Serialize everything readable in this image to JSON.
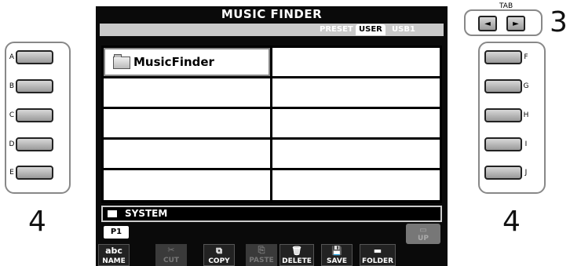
{
  "screen": {
    "title": "MUSIC FINDER",
    "tabs": {
      "preset": "PRESET",
      "user": "USER",
      "usb": "USB1"
    },
    "files": [
      {
        "label": "MusicFinder",
        "type": "folder",
        "selected": true
      }
    ],
    "system_label": "SYSTEM",
    "page_tab": "P1",
    "up_label": "UP",
    "bottom_buttons": [
      {
        "label": "NAME",
        "enabled": true,
        "glyph": "abc"
      },
      {
        "label": "CUT",
        "enabled": false,
        "glyph": "✂"
      },
      {
        "label": "COPY",
        "enabled": true,
        "glyph": "⧉"
      },
      {
        "label": "PASTE",
        "enabled": false,
        "glyph": "⎘"
      },
      {
        "label": "DELETE",
        "enabled": true,
        "glyph": "🗑"
      },
      {
        "label": "SAVE",
        "enabled": true,
        "glyph": "💾"
      },
      {
        "label": "FOLDER",
        "enabled": true,
        "glyph": "▬"
      }
    ]
  },
  "left_buttons": [
    "A",
    "B",
    "C",
    "D",
    "E"
  ],
  "right_buttons": [
    "F",
    "G",
    "H",
    "I",
    "J"
  ],
  "tab_caption": "TAB",
  "tab_arrows": {
    "left": "◄",
    "right": "►"
  },
  "callouts": {
    "left": "4",
    "right": "4",
    "tab": "3"
  },
  "colors": {
    "screen_bg": "#0a0a0a",
    "tab_strip": "#c9c9c9",
    "button_face": "#b8b8b8"
  }
}
